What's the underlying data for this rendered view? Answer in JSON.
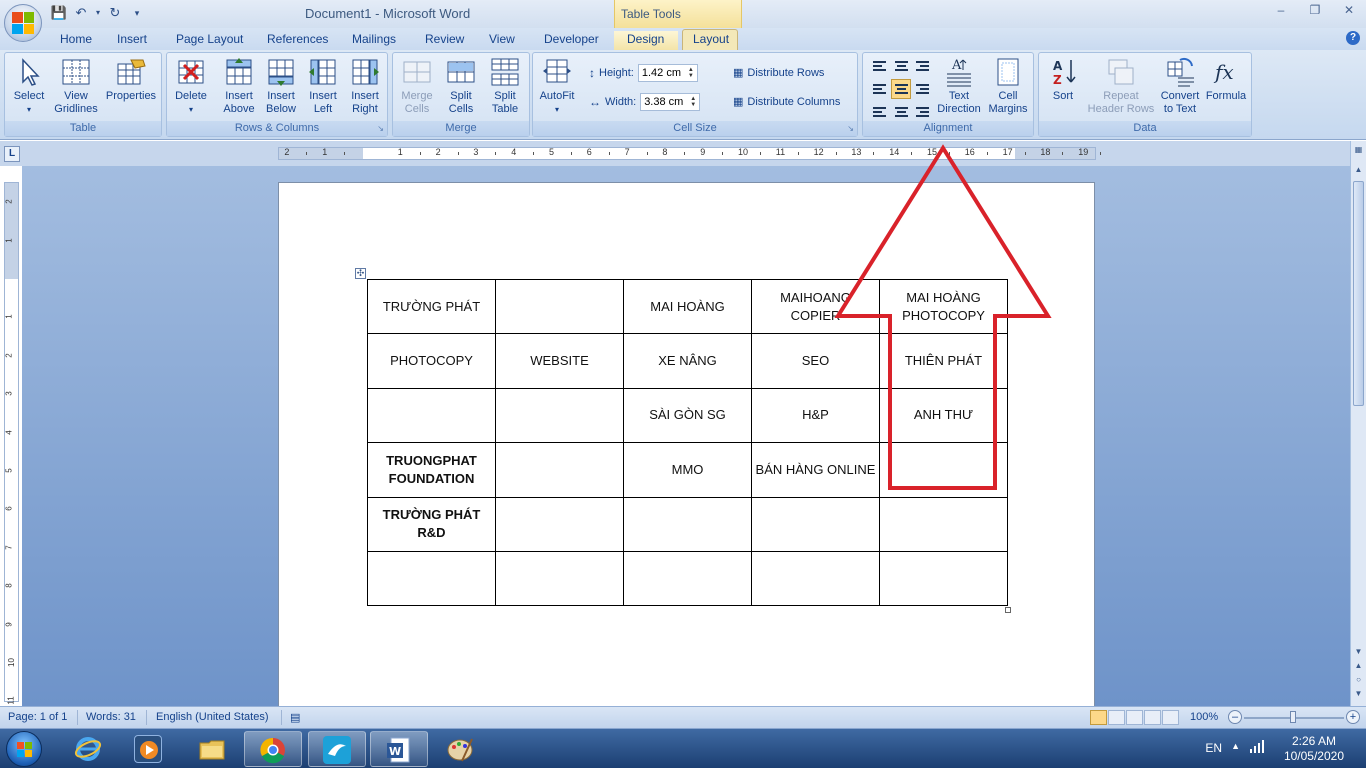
{
  "window": {
    "title": "Document1 - Microsoft Word",
    "context_tab_group": "Table Tools"
  },
  "tabs": [
    "Home",
    "Insert",
    "Page Layout",
    "References",
    "Mailings",
    "Review",
    "View",
    "Developer",
    "Design",
    "Layout"
  ],
  "active_tab": "Layout",
  "ribbon": {
    "table_group": {
      "label": "Table",
      "buttons": [
        {
          "line1": "Select",
          "line2": ""
        },
        {
          "line1": "View",
          "line2": "Gridlines"
        },
        {
          "line1": "Properties",
          "line2": ""
        }
      ]
    },
    "rows_columns_group": {
      "label": "Rows & Columns",
      "buttons": [
        {
          "line1": "Delete",
          "line2": ""
        },
        {
          "line1": "Insert",
          "line2": "Above"
        },
        {
          "line1": "Insert",
          "line2": "Below"
        },
        {
          "line1": "Insert",
          "line2": "Left"
        },
        {
          "line1": "Insert",
          "line2": "Right"
        }
      ]
    },
    "merge_group": {
      "label": "Merge",
      "buttons": [
        {
          "line1": "Merge",
          "line2": "Cells"
        },
        {
          "line1": "Split",
          "line2": "Cells"
        },
        {
          "line1": "Split",
          "line2": "Table"
        }
      ]
    },
    "cell_size_group": {
      "label": "Cell Size",
      "autofit": "AutoFit",
      "height_label": "Height:",
      "height_value": "1.42 cm",
      "width_label": "Width:",
      "width_value": "3.38 cm",
      "distribute_rows": "Distribute Rows",
      "distribute_columns": "Distribute Columns"
    },
    "alignment_group": {
      "label": "Alignment",
      "buttons": [
        {
          "line1": "Text",
          "line2": "Direction"
        },
        {
          "line1": "Cell",
          "line2": "Margins"
        }
      ]
    },
    "data_group": {
      "label": "Data",
      "buttons": [
        {
          "line1": "Sort",
          "line2": ""
        },
        {
          "line1": "Repeat",
          "line2": "Header Rows"
        },
        {
          "line1": "Convert",
          "line2": "to Text"
        },
        {
          "line1": "Formula",
          "line2": ""
        }
      ]
    }
  },
  "ruler": {
    "numbers": [
      "2",
      "1",
      "1",
      "2",
      "3",
      "4",
      "5",
      "6",
      "7",
      "8",
      "9",
      "10",
      "11",
      "12",
      "13",
      "14",
      "15",
      "16",
      "17",
      "18",
      "19"
    ],
    "vertical_numbers": [
      "2",
      "1",
      "1",
      "2",
      "3",
      "4",
      "5",
      "6",
      "7",
      "8",
      "9",
      "10",
      "11"
    ]
  },
  "table": {
    "rows": [
      [
        "TRƯỜNG PHÁT",
        "",
        "MAI HOÀNG",
        "MAIHOANG COPIER",
        "MAI HOÀNG PHOTOCOPY"
      ],
      [
        "PHOTOCOPY",
        "WEBSITE",
        "XE NÂNG",
        "SEO",
        "THIÊN PHÁT"
      ],
      [
        "",
        "",
        "SÀI GÒN SG",
        "H&P",
        "ANH  THƯ"
      ],
      [
        "TRUONGPHAT FOUNDATION",
        "",
        "MMO",
        "BÁN HÀNG ONLINE",
        ""
      ],
      [
        "TRƯỜNG PHÁT R&D",
        "",
        "",
        "",
        ""
      ],
      [
        "",
        "",
        "",
        "",
        ""
      ]
    ],
    "bold_cells": [
      [
        3,
        0
      ],
      [
        4,
        0
      ]
    ]
  },
  "status": {
    "page": "Page: 1 of 1",
    "words": "Words: 31",
    "language": "English (United States)",
    "zoom": "100%"
  },
  "taskbar": {
    "language": "EN",
    "time": "2:26 AM",
    "date": "10/05/2020"
  },
  "colors": {
    "annotation_arrow": "#d9222a",
    "ribbon_bg": "#c5d8ef",
    "context_tab": "#f3e4a8"
  }
}
